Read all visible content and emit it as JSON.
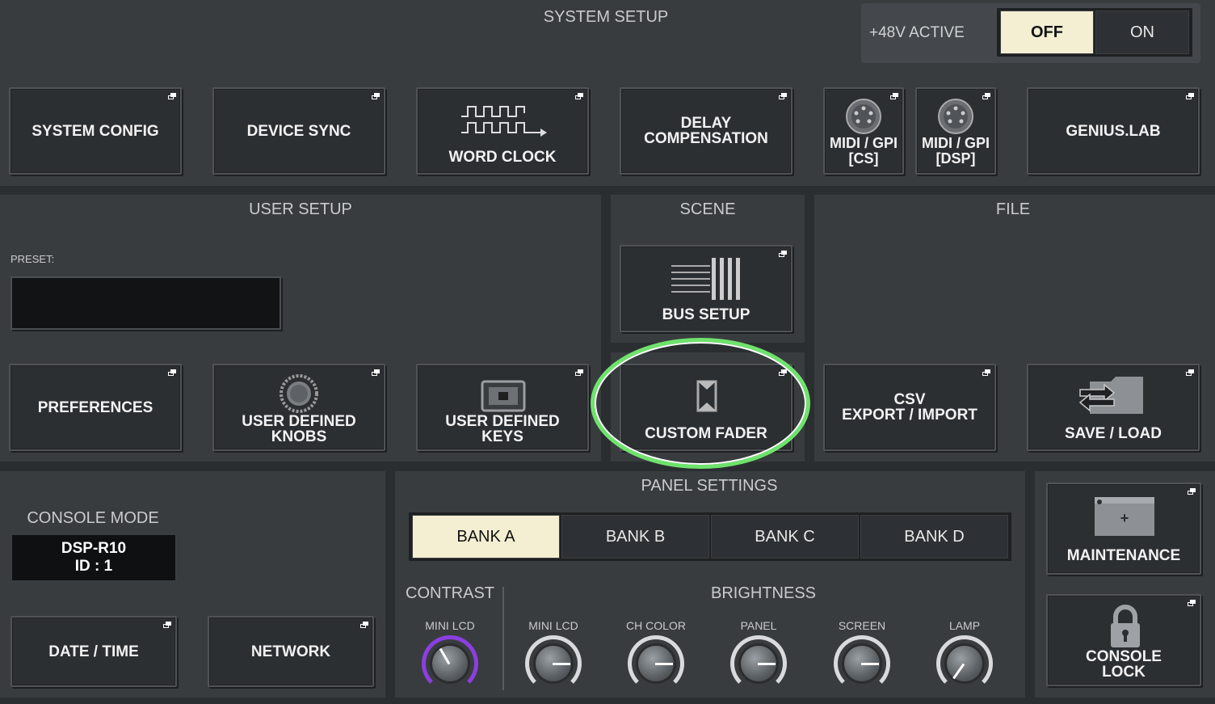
{
  "system_setup": {
    "title": "SYSTEM SETUP",
    "phantom_label": "+48V ACTIVE",
    "phantom_off": "OFF",
    "phantom_on": "ON",
    "phantom_state": "OFF",
    "buttons": {
      "system_config": "SYSTEM CONFIG",
      "device_sync": "DEVICE SYNC",
      "word_clock": "WORD CLOCK",
      "delay_compensation": "DELAY\nCOMPENSATION",
      "midi_gpi_cs": "MIDI / GPI\n[CS]",
      "midi_gpi_dsp": "MIDI / GPI\n[DSP]",
      "genius_lab": "GENIUS.LAB"
    }
  },
  "user_setup": {
    "title": "USER SETUP",
    "preset_label": "PRESET:",
    "preset_value": "",
    "buttons": {
      "preferences": "PREFERENCES",
      "user_defined_knobs": "USER DEFINED\nKNOBS",
      "user_defined_keys": "USER DEFINED\nKEYS"
    }
  },
  "scene": {
    "title": "SCENE",
    "bus_setup": "BUS SETUP",
    "custom_fader": "CUSTOM FADER",
    "highlight_color": "#6ee36b"
  },
  "file": {
    "title": "FILE",
    "csv": "CSV\nEXPORT / IMPORT",
    "save_load": "SAVE / LOAD"
  },
  "console": {
    "mode_label": "CONSOLE MODE",
    "mode_value": "DSP-R10\nID : 1",
    "date_time": "DATE / TIME",
    "network": "NETWORK"
  },
  "panel_settings": {
    "title": "PANEL SETTINGS",
    "banks": [
      "BANK A",
      "BANK B",
      "BANK C",
      "BANK D"
    ],
    "active_bank": "BANK A",
    "contrast_label": "CONTRAST",
    "brightness_label": "BRIGHTNESS",
    "knobs": [
      {
        "label": "MINI LCD",
        "group": "contrast",
        "angle_deg": 240,
        "ring": "purple"
      },
      {
        "label": "MINI LCD",
        "group": "brightness",
        "angle_deg": 0,
        "ring": "white"
      },
      {
        "label": "CH COLOR",
        "group": "brightness",
        "angle_deg": 0,
        "ring": "white"
      },
      {
        "label": "PANEL",
        "group": "brightness",
        "angle_deg": 0,
        "ring": "white"
      },
      {
        "label": "SCREEN",
        "group": "brightness",
        "angle_deg": 0,
        "ring": "white"
      },
      {
        "label": "LAMP",
        "group": "brightness",
        "angle_deg": 125,
        "ring": "white"
      }
    ]
  },
  "side": {
    "maintenance": "MAINTENANCE",
    "console_lock": "CONSOLE\nLOCK"
  },
  "colors": {
    "active_segment": "#f4efd2",
    "purple_ring": "#8b3fe0",
    "panel_bg": "#393c3f"
  }
}
